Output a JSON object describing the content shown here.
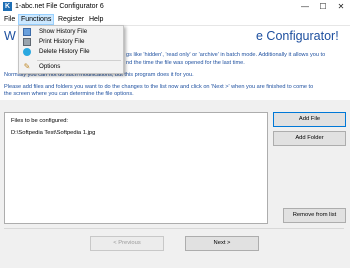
{
  "window": {
    "title": "1-abc.net File Configurator 6",
    "app_icon": "app-logo-icon",
    "controls": [
      "minimize-icon",
      "maximize-icon",
      "close-icon"
    ]
  },
  "menubar": {
    "items": [
      "File",
      "Functions",
      "Register",
      "Help"
    ],
    "active": "Functions"
  },
  "functions_menu": {
    "items": [
      {
        "label": "Show History File",
        "icon": "history-grid-icon"
      },
      {
        "label": "Print History File",
        "icon": "printer-icon"
      },
      {
        "label": "Delete History File",
        "icon": "delete-icon"
      },
      {
        "label": "Options",
        "icon": "options-icon"
      }
    ]
  },
  "header": {
    "title_left": "W",
    "title_right": "e Configurator!",
    "lines": [
      "gs like 'hidden', 'read only' or 'archive' in batch mode. Additionally it allows you to",
      "nd the time the file was opened for the last time.",
      "Normally you can not do such modifications, but this program does it for you.",
      "Please add files and folders you want to do the changes to the list now and click on 'Next >' when you are finished to come to",
      "the screen where you can determine the file options."
    ]
  },
  "files": {
    "header": "Files to be configured:",
    "items": [
      "D:\\Softpedia Test\\Softpedia 1.jpg"
    ]
  },
  "buttons": {
    "add_file": "Add File",
    "add_folder": "Add Folder",
    "remove": "Remove from list",
    "previous": "< Previous",
    "next": "Next >"
  },
  "colors": {
    "heading_blue": "#1d4f9f",
    "menu_highlight": "#cce8ff",
    "focus_border": "#0078d7"
  }
}
